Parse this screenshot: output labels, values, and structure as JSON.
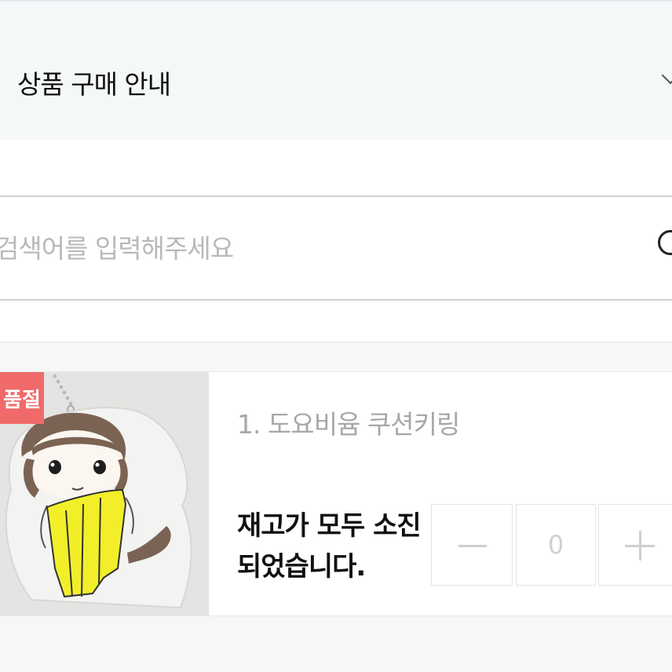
{
  "accordion": {
    "title": "상품 구매 안내"
  },
  "search": {
    "placeholder": "검색어를 입력해주세요",
    "value": ""
  },
  "products": [
    {
      "badge": "품절",
      "name": "1. 도요비윰 쿠션키링",
      "stock_message": "재고가 모두 소진되었습니다.",
      "quantity": "0",
      "thumbnail": "cushion-keyring-character-image"
    }
  ],
  "colors": {
    "badge": "#f06a6a",
    "accordion_bg": "#f5f8f9",
    "keyring_yellow": "#f2ef2a"
  }
}
